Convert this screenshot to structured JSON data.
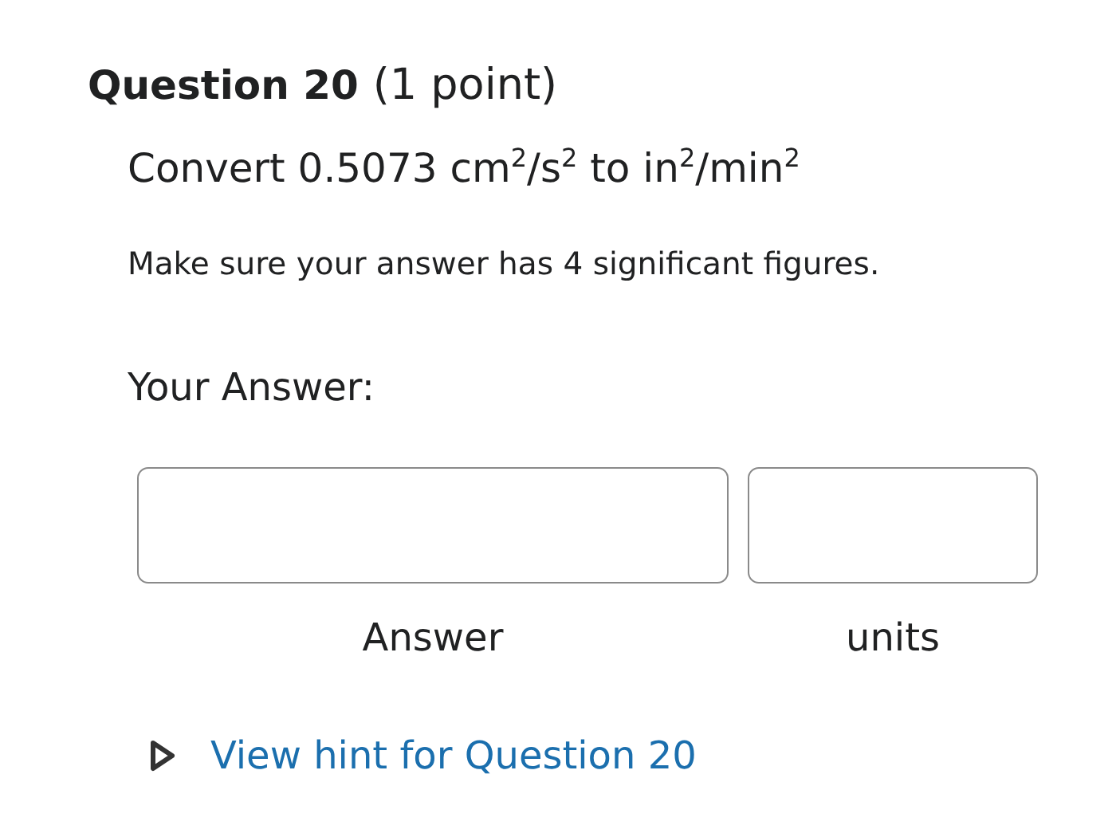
{
  "question": {
    "title": "Question 20",
    "points": "(1 point)"
  },
  "prompt": "Convert 0.5073 cm$^{2}$/s$^{2}$ to in$^{2}$/min$^{2}$",
  "instruction": "Make sure your answer has 4 significant figures.",
  "answer_heading": "Your Answer:",
  "fields": [
    {
      "label": "Answer"
    },
    {
      "label": "units"
    }
  ],
  "hint_link": "View hint for Question 20"
}
